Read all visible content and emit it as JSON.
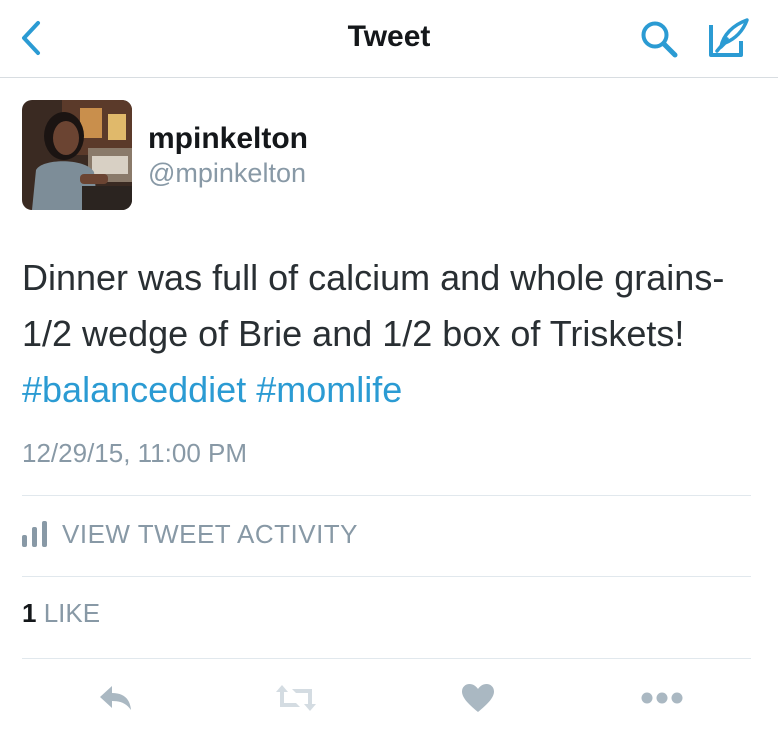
{
  "header": {
    "title": "Tweet",
    "back_icon": "chevron-left-icon",
    "search_icon": "search-icon",
    "compose_icon": "compose-icon"
  },
  "author": {
    "name": "mpinkelton",
    "handle": "@mpinkelton"
  },
  "tweet": {
    "text_plain": "Dinner was full of calcium and whole grains- 1/2 wedge of Brie and 1/2 box of Triskets! ",
    "hashtag1": "#balanceddiet",
    "hashtag2": "#momlife",
    "timestamp": "12/29/15, 11:00 PM"
  },
  "activity": {
    "label": "VIEW TWEET ACTIVITY"
  },
  "likes": {
    "count": "1",
    "label": "LIKE"
  },
  "actions": [
    "reply-icon",
    "retweet-icon",
    "heart-icon",
    "more-icon"
  ],
  "colors": {
    "accent": "#2b9bd3",
    "muted": "#8899a6",
    "icon_gray": "#aab8c2",
    "text": "#292f33"
  }
}
